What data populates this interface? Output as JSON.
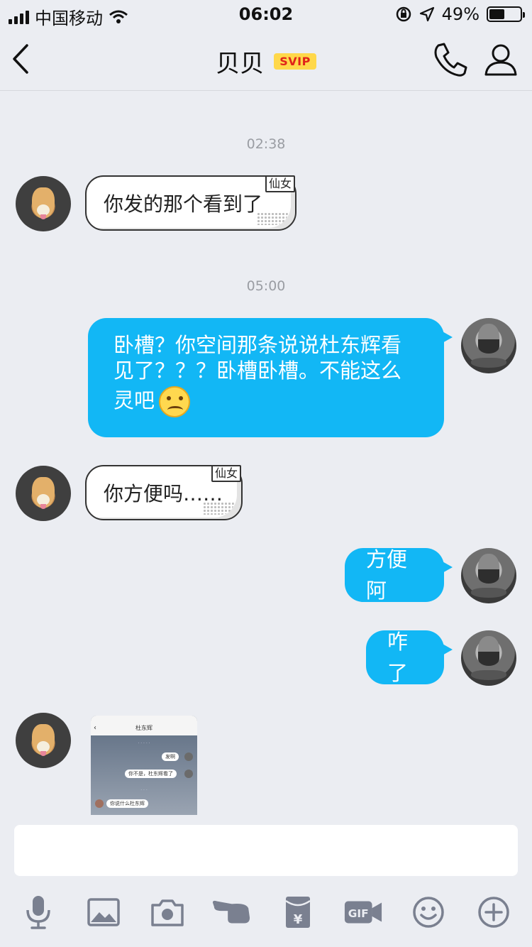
{
  "status_bar": {
    "carrier": "中国移动",
    "time": "06:02",
    "battery_percent": "49%",
    "battery_level": 0.49
  },
  "nav": {
    "title": "贝贝",
    "badge": "SVIP"
  },
  "messages": {
    "ts1": "02:38",
    "m1_text": "你发的那个看到了",
    "m1_tag": "仙女",
    "ts2": "05:00",
    "m2_line1": "卧槽？你空间那条说说杜东辉看",
    "m2_line2": "见了？？？卧槽卧槽。不能这么",
    "m2_line3": "灵吧",
    "m3_text": "你方便吗……",
    "m3_tag": "仙女",
    "m4_text": "方便阿",
    "m5_text": "咋了"
  },
  "thumbnail": {
    "title": "杜东辉",
    "msg1": "发啊",
    "msg2": "你不是，杜东辉看了",
    "msg3": "你说什么杜东辉"
  },
  "toolbar_icons": [
    "mic-icon",
    "image-icon",
    "camera-icon",
    "poke-icon",
    "red-packet-icon",
    "gif-icon",
    "emoji-icon",
    "plus-icon"
  ],
  "colors": {
    "accent": "#12b7f5",
    "background": "#ebedf2",
    "icon": "#7a8090"
  }
}
